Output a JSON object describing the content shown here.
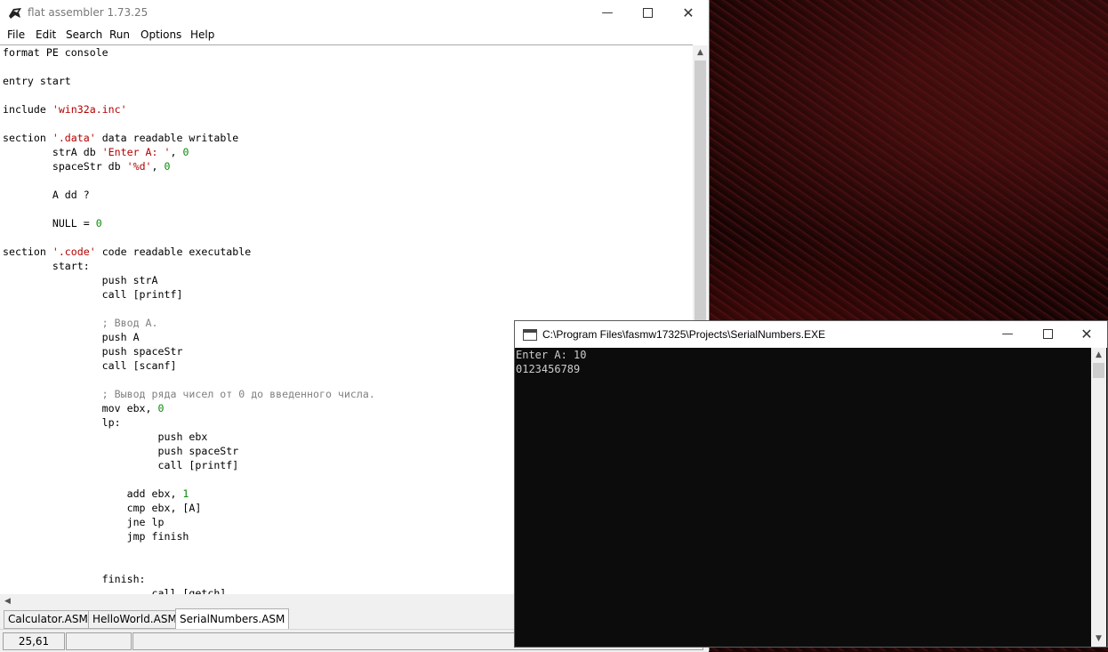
{
  "fasm": {
    "title": "flat assembler 1.73.25",
    "menu": [
      "File",
      "Edit",
      "Search",
      "Run",
      "Options",
      "Help"
    ],
    "code_lines": [
      [
        [
          "format PE console",
          ""
        ]
      ],
      [
        [
          "",
          ""
        ]
      ],
      [
        [
          "entry start",
          ""
        ]
      ],
      [
        [
          "",
          ""
        ]
      ],
      [
        [
          "include ",
          ""
        ],
        [
          "'win32a.inc'",
          "str"
        ]
      ],
      [
        [
          "",
          ""
        ]
      ],
      [
        [
          "section ",
          ""
        ],
        [
          "'.data'",
          "str"
        ],
        [
          " data readable writable",
          ""
        ]
      ],
      [
        [
          "        strA db ",
          ""
        ],
        [
          "'Enter A: '",
          "str"
        ],
        [
          ", ",
          ""
        ],
        [
          "0",
          "num"
        ]
      ],
      [
        [
          "        spaceStr db ",
          ""
        ],
        [
          "'%d'",
          "str"
        ],
        [
          ", ",
          ""
        ],
        [
          "0",
          "num"
        ]
      ],
      [
        [
          "",
          ""
        ]
      ],
      [
        [
          "        A dd ?",
          ""
        ]
      ],
      [
        [
          "",
          ""
        ]
      ],
      [
        [
          "        NULL = ",
          ""
        ],
        [
          "0",
          "num"
        ]
      ],
      [
        [
          "",
          ""
        ]
      ],
      [
        [
          "section ",
          ""
        ],
        [
          "'.code'",
          "str"
        ],
        [
          " code readable executable",
          ""
        ]
      ],
      [
        [
          "        start:",
          ""
        ]
      ],
      [
        [
          "                push strA",
          ""
        ]
      ],
      [
        [
          "                call [printf]",
          ""
        ]
      ],
      [
        [
          "",
          ""
        ]
      ],
      [
        [
          "                ; Ввод А.",
          "cmt"
        ]
      ],
      [
        [
          "                push A",
          ""
        ]
      ],
      [
        [
          "                push spaceStr",
          ""
        ]
      ],
      [
        [
          "                call [scanf]",
          ""
        ]
      ],
      [
        [
          "",
          ""
        ]
      ],
      [
        [
          "                ; Вывод ряда чисел от 0 до введенного числа.",
          "cmt"
        ]
      ],
      [
        [
          "                mov ebx, ",
          ""
        ],
        [
          "0",
          "num"
        ]
      ],
      [
        [
          "                lp:",
          ""
        ]
      ],
      [
        [
          "                         push ebx",
          ""
        ]
      ],
      [
        [
          "                         push spaceStr",
          ""
        ]
      ],
      [
        [
          "                         call [printf]",
          ""
        ]
      ],
      [
        [
          "",
          ""
        ]
      ],
      [
        [
          "                    add ebx, ",
          ""
        ],
        [
          "1",
          "num"
        ]
      ],
      [
        [
          "                    cmp ebx, [A]",
          ""
        ]
      ],
      [
        [
          "                    jne lp",
          ""
        ]
      ],
      [
        [
          "                    jmp finish",
          ""
        ]
      ],
      [
        [
          "",
          ""
        ]
      ],
      [
        [
          "",
          ""
        ]
      ],
      [
        [
          "                finish:",
          ""
        ]
      ],
      [
        [
          "                        call [getch]",
          ""
        ]
      ]
    ],
    "tabs": [
      "Calculator.ASM",
      "HelloWorld.ASM",
      "SerialNumbers.ASM"
    ],
    "active_tab": 2,
    "status": {
      "position": "25,61",
      "pane2": "",
      "pane3": ""
    }
  },
  "console": {
    "title": "C:\\Program Files\\fasmw17325\\Projects\\SerialNumbers.EXE",
    "output": "Enter A: 10\n0123456789"
  },
  "icons": {
    "minimize": "minimize-icon",
    "maximize": "maximize-icon",
    "close": "close-icon"
  }
}
